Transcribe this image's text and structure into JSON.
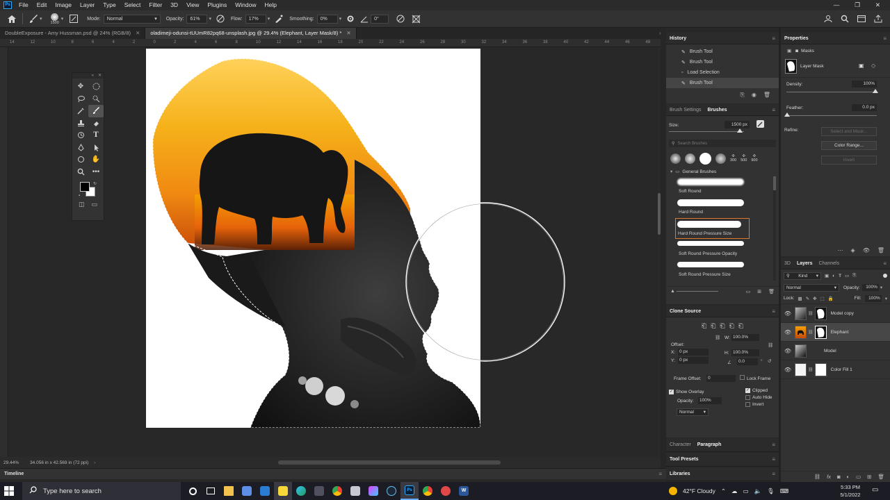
{
  "menu": [
    "File",
    "Edit",
    "Image",
    "Layer",
    "Type",
    "Select",
    "Filter",
    "3D",
    "View",
    "Plugins",
    "Window",
    "Help"
  ],
  "options": {
    "brush_size": "1500",
    "mode_label": "Mode:",
    "mode_value": "Normal",
    "opacity_label": "Opacity:",
    "opacity_value": "61%",
    "flow_label": "Flow:",
    "flow_value": "17%",
    "smoothing_label": "Smoothing:",
    "smoothing_value": "0%",
    "angle_value": "0°"
  },
  "tabs": [
    {
      "label": "DoubleExposure - Amy Hussman.psd @ 24% (RGB/8)",
      "active": false
    },
    {
      "label": "oladimeji-odunsi-tUUmR82pq68-unsplash.jpg @ 29.4% (Elephant, Layer Mask/8) *",
      "active": true
    }
  ],
  "ruler_ticks": [
    "14",
    "12",
    "10",
    "8",
    "6",
    "4",
    "2",
    "0",
    "2",
    "4",
    "6",
    "8",
    "10",
    "12",
    "14",
    "16",
    "18",
    "20",
    "22",
    "24",
    "26",
    "28",
    "30",
    "32",
    "34",
    "36",
    "38",
    "40",
    "42",
    "44",
    "46",
    "48"
  ],
  "status": {
    "zoom": "29.44%",
    "doc_size": "34.056 in x 42.569 in (72 ppi)"
  },
  "timeline_label": "Timeline",
  "history": {
    "title": "History",
    "items": [
      {
        "label": "Brush Tool",
        "selected": false
      },
      {
        "label": "Brush Tool",
        "selected": false
      },
      {
        "label": "Load Selection",
        "selected": false
      },
      {
        "label": "Brush Tool",
        "selected": true
      }
    ]
  },
  "brushes": {
    "tab_settings": "Brush Settings",
    "tab_brushes": "Brushes",
    "size_label": "Size:",
    "size_value": "1500 px",
    "search_placeholder": "Search Brushes",
    "preset_sizes": [
      "300",
      "500",
      "900"
    ],
    "group": "General Brushes",
    "items": [
      {
        "label": "Soft Round",
        "selected": false
      },
      {
        "label": "Hard Round",
        "selected": false
      },
      {
        "label": "Hard Round Pressure Size",
        "selected": true
      },
      {
        "label": "Soft Round Pressure Opacity",
        "selected": false
      },
      {
        "label": "Soft Round Pressure Size",
        "selected": false
      }
    ]
  },
  "clone_source": {
    "title": "Clone Source",
    "offset_label": "Offset:",
    "x_label": "X:",
    "x_value": "0 px",
    "y_label": "Y:",
    "y_value": "0 px",
    "w_label": "W:",
    "w_value": "100.0%",
    "h_label": "H:",
    "h_value": "100.0%",
    "angle_value": "0.0",
    "frame_offset_label": "Frame Offset:",
    "frame_offset_value": "0",
    "lock_frame": "Lock Frame",
    "show_overlay": "Show Overlay",
    "opacity_label": "Opacity:",
    "opacity_value": "100%",
    "blend": "Normal",
    "clipped": "Clipped",
    "auto_hide": "Auto Hide",
    "invert": "Invert"
  },
  "character_tabs": {
    "character": "Character",
    "paragraph": "Paragraph"
  },
  "tool_presets": "Tool Presets",
  "libraries": "Libraries",
  "properties": {
    "title": "Properties",
    "masks_label": "Masks",
    "layer_mask": "Layer Mask",
    "density_label": "Density:",
    "density_value": "100%",
    "feather_label": "Feather:",
    "feather_value": "0.0 px",
    "refine_label": "Refine:",
    "select_mask": "Select and Mask...",
    "color_range": "Color Range...",
    "invert": "Invert"
  },
  "layers": {
    "tab_3d": "3D",
    "tab_layers": "Layers",
    "tab_channels": "Channels",
    "kind": "Kind",
    "blend": "Normal",
    "opacity_label": "Opacity:",
    "opacity_value": "100%",
    "lock_label": "Lock:",
    "fill_label": "Fill:",
    "fill_value": "100%",
    "items": [
      {
        "name": "Model copy",
        "selected": false
      },
      {
        "name": "Elephant",
        "selected": true
      },
      {
        "name": "Model",
        "selected": false
      },
      {
        "name": "Color Fill 1",
        "selected": false
      }
    ]
  },
  "taskbar": {
    "search_placeholder": "Type here to search",
    "weather": "42°F  Cloudy",
    "time": "5:33 PM",
    "date": "5/1/2022"
  },
  "colors": {
    "accent": "#31a8ff",
    "selected_brush_border": "#e0772a",
    "panel_bg": "#323232"
  }
}
